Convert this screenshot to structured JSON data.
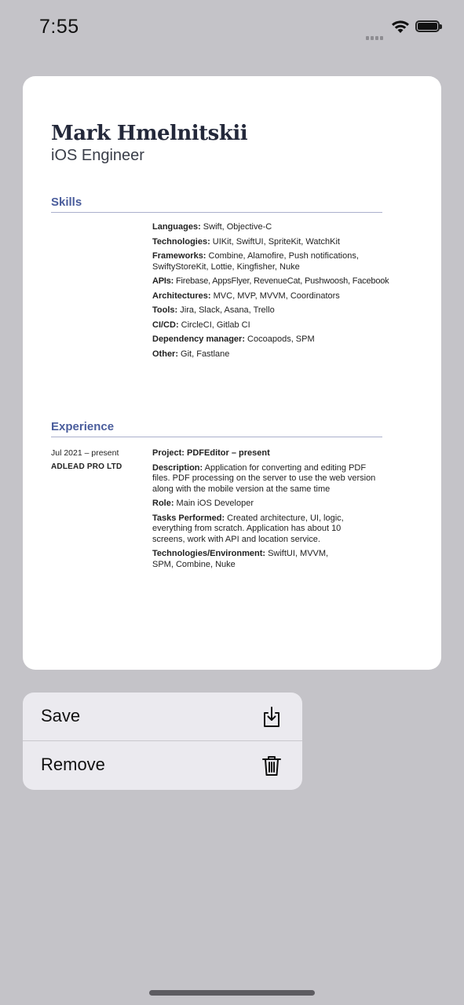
{
  "status_bar": {
    "time": "7:55"
  },
  "resume": {
    "name": "Mark Hmelnitskii",
    "role": "iOS Engineer",
    "skills_title": "Skills",
    "skills": [
      {
        "label": "Languages:",
        "value": " Swift, Objective-C"
      },
      {
        "label": "Technologies:",
        "value": " UIKit, SwiftUI, SpriteKit, WatchKit"
      },
      {
        "label": "Frameworks:",
        "value": " Combine, Alamofire, Push notifications, SwiftyStoreKit, Lottie, Kingfisher, Nuke"
      },
      {
        "label": "APIs:",
        "value": " Firebase, AppsFlyer, RevenueCat, Pushwoosh, Facebook"
      },
      {
        "label": "Architectures:",
        "value": " MVC, MVP, MVVM, Coordinators"
      },
      {
        "label": "Tools:",
        "value": " Jira, Slack, Asana, Trello"
      },
      {
        "label": "CI/CD:",
        "value": " CircleCI, Gitlab CI"
      },
      {
        "label": "Dependency manager:",
        "value": " Cocoapods, SPM"
      },
      {
        "label": "Other:",
        "value": " Git, Fastlane"
      }
    ],
    "experience_title": "Experience",
    "experience": {
      "period": "Jul 2021 – present",
      "company": "ADLEAD PRO LTD",
      "project": "Project: PDFEditor – present",
      "details": [
        {
          "label": "Description:",
          "value": " Application for converting and editing PDF files. PDF processing on the server to use the web version along with the mobile version at the same time"
        },
        {
          "label": "Role:",
          "value": " Main iOS Developer"
        },
        {
          "label": "Tasks Performed:",
          "value": " Created architecture, UI, logic, everything from scratch. Application has about 10 screens,  work with API and location service."
        },
        {
          "label": "Technologies/Environment:",
          "value": " SwiftUI, MVVM, SPM, Combine,  Nuke"
        }
      ]
    }
  },
  "context_menu": {
    "save_label": "Save",
    "remove_label": "Remove",
    "save_icon": "square-and-arrow-down-icon",
    "remove_icon": "trash-icon"
  },
  "colors": {
    "accent": "#4a5d9c",
    "backdrop": "#c4c3c8",
    "menu_background": "#ebeaef"
  }
}
